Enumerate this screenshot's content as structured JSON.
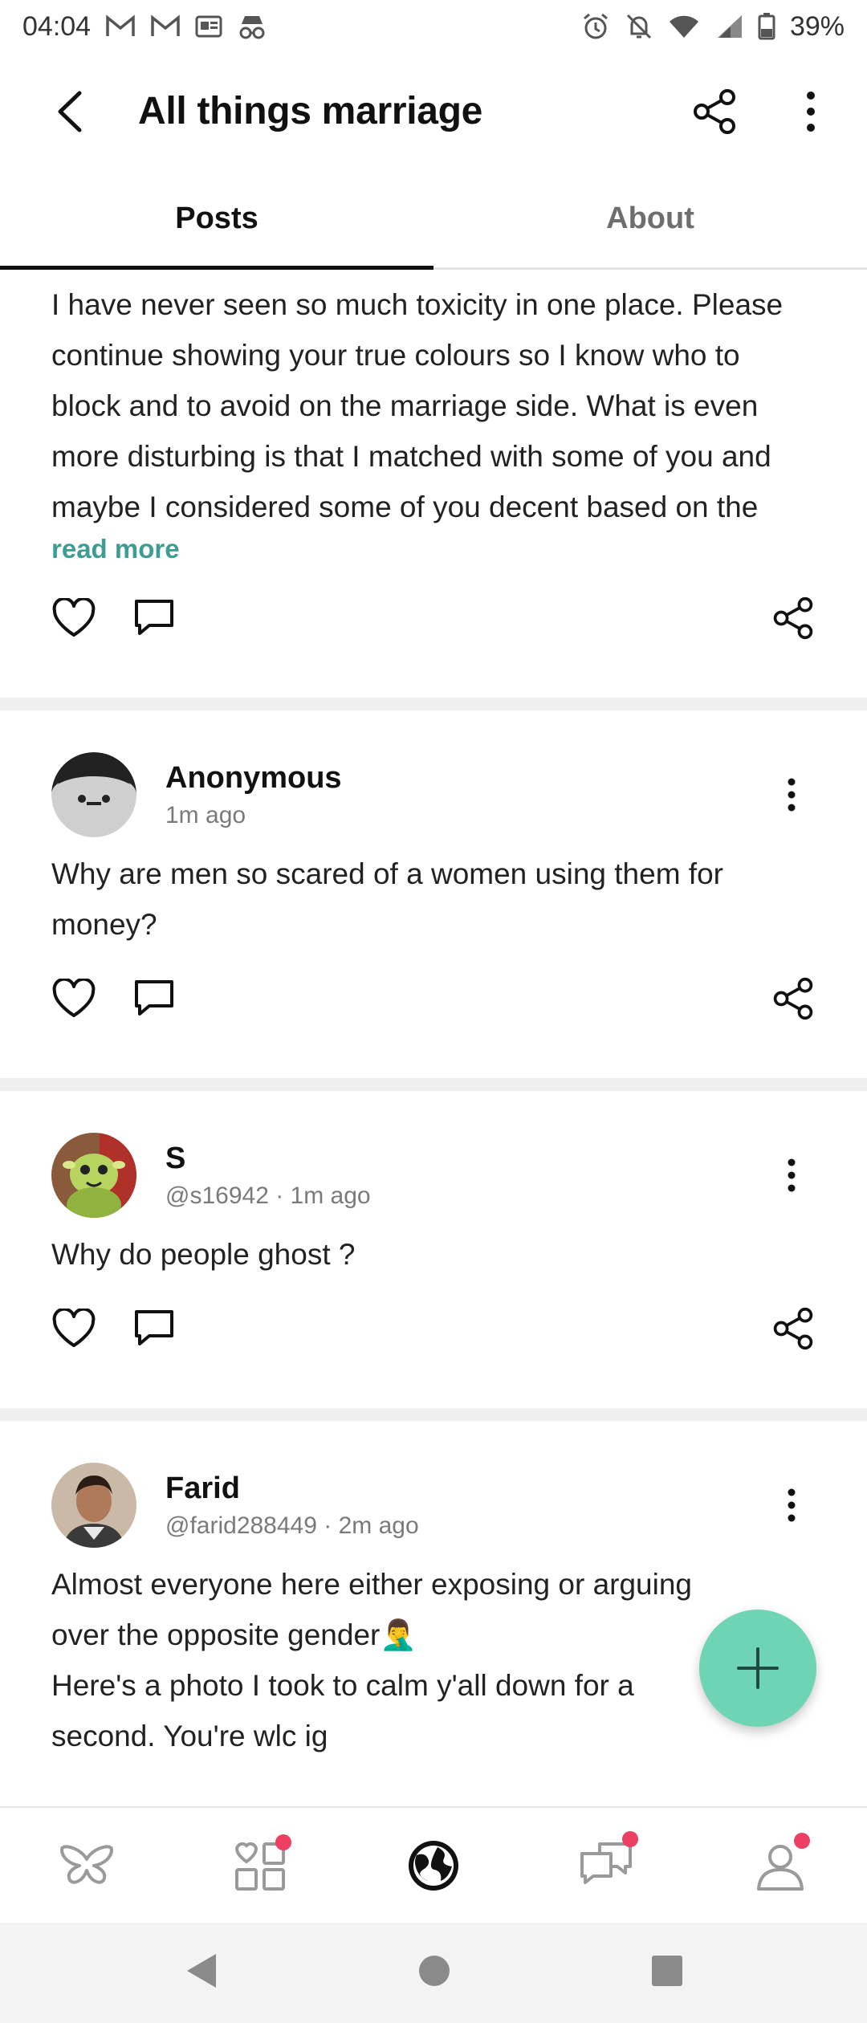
{
  "status_bar": {
    "time": "04:04",
    "battery": "39%",
    "left_icons": [
      "gmail-icon",
      "gmail-icon",
      "news-icon",
      "incognito-icon"
    ],
    "right_icons": [
      "alarm-icon",
      "bell-off-icon",
      "wifi-icon",
      "signal-icon",
      "battery-icon"
    ]
  },
  "app_bar": {
    "title": "All things marriage"
  },
  "tabs": [
    {
      "label": "Posts",
      "active": true
    },
    {
      "label": "About",
      "active": false
    }
  ],
  "posts": [
    {
      "body": "I have never seen so much toxicity in one place. Please continue showing your true colours so I know who to block and to avoid on the marriage side. What is even more disturbing is that I matched with some of you and maybe I considered some of you decent based on the limi...",
      "read_more": "read more"
    },
    {
      "author": "Anonymous",
      "meta": "1m ago",
      "body": "Why are men so scared of a women using them for money?"
    },
    {
      "author": "S",
      "meta": "@s16942 · 1m ago",
      "body": "Why do people ghost ?"
    },
    {
      "author": "Farid",
      "meta": "@farid288449 · 2m ago",
      "body_line1": "Almost everyone here either exposing or arguing",
      "body_line2": "over the opposite gender🤦‍♂️",
      "body_line3": "Here's a photo I took to calm y'all down for a",
      "body_line4": "second. You're wlc ig"
    }
  ],
  "colors": {
    "accent": "#3f9c93",
    "fab": "#6fd4b4",
    "badge": "#ec3f61"
  },
  "bottom_nav": [
    "butterfly-icon",
    "matches-icon",
    "globe-icon",
    "chat-icon",
    "profile-icon"
  ]
}
